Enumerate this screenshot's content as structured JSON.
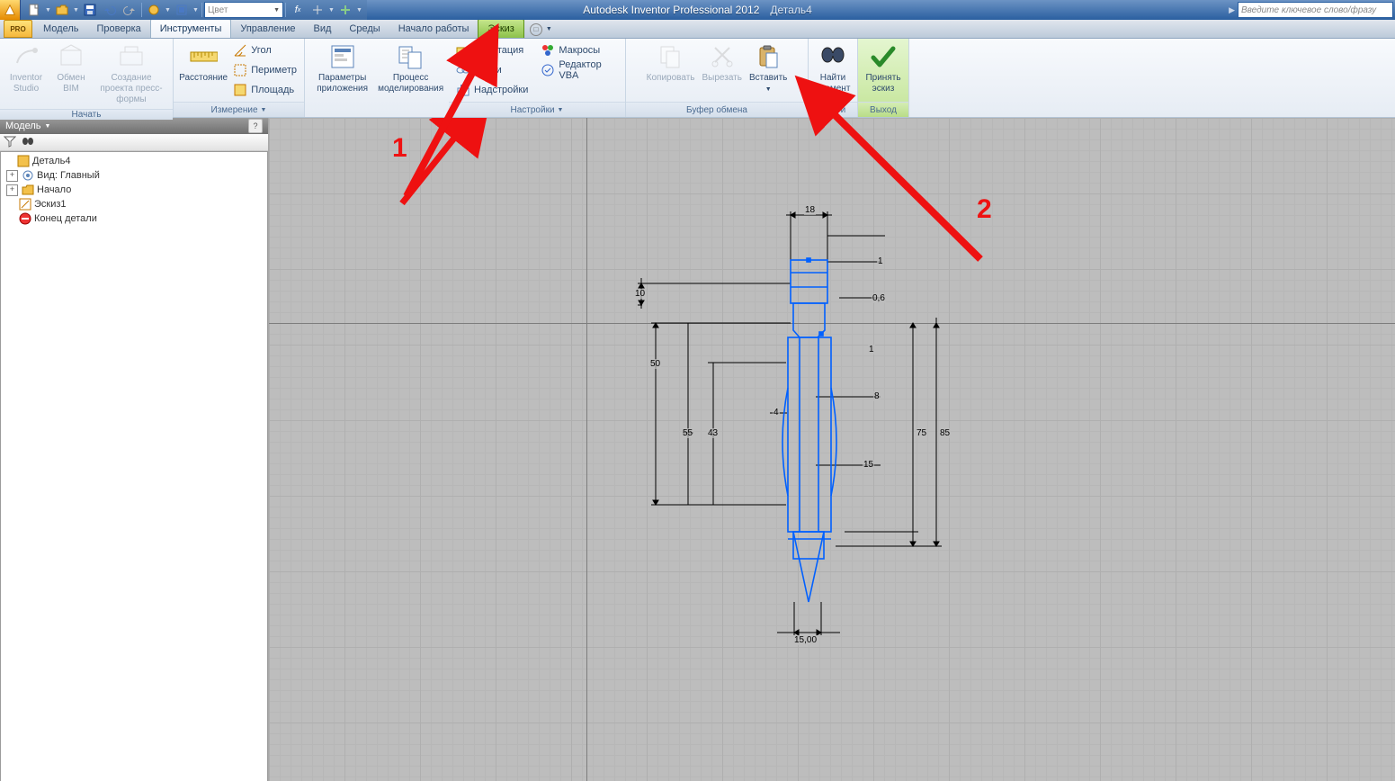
{
  "title": {
    "app": "Autodesk Inventor Professional 2012",
    "doc": "Деталь4"
  },
  "search_placeholder": "Введите ключевое слово/фразу",
  "qat_combo": "Цвет",
  "tabs": [
    "Модель",
    "Проверка",
    "Инструменты",
    "Управление",
    "Вид",
    "Среды",
    "Начало работы",
    "Эскиз"
  ],
  "ribbon": {
    "panels": [
      {
        "label": "Начать",
        "big": [
          {
            "id": "inventor-studio",
            "lbl": "Inventor Studio",
            "disabled": true
          },
          {
            "id": "obmen-bim",
            "lbl": "Обмен BIM",
            "disabled": true
          },
          {
            "id": "press-form",
            "lbl": "Создание проекта пресс-формы",
            "disabled": true
          }
        ]
      },
      {
        "label": "Измерение",
        "dd": true,
        "big": [
          {
            "id": "distance",
            "lbl": "Расстояние"
          }
        ],
        "small": [
          {
            "id": "angle",
            "lbl": "Угол"
          },
          {
            "id": "perimeter",
            "lbl": "Периметр"
          },
          {
            "id": "area",
            "lbl": "Площадь"
          }
        ]
      },
      {
        "label": "",
        "big": [
          {
            "id": "app-params",
            "lbl": "Параметры приложения"
          },
          {
            "id": "model-process",
            "lbl": "Процесс моделирования"
          }
        ]
      },
      {
        "label": "Настройки",
        "dd": true,
        "small": [
          {
            "id": "adaptation",
            "lbl": "Адаптация"
          },
          {
            "id": "links",
            "lbl": "Связи"
          },
          {
            "id": "addins",
            "lbl": "Надстройки"
          }
        ],
        "small2": [
          {
            "id": "macros",
            "lbl": "Макросы"
          },
          {
            "id": "vba",
            "lbl": "Редактор VBA"
          }
        ]
      },
      {
        "label": "Буфер обмена",
        "big": [
          {
            "id": "copy",
            "lbl": "Копировать",
            "disabled": true
          },
          {
            "id": "cut",
            "lbl": "Вырезать",
            "disabled": true
          },
          {
            "id": "paste",
            "lbl": "Вставить",
            "dd": true
          }
        ]
      },
      {
        "label": "Найти",
        "big": [
          {
            "id": "find",
            "lbl": "Найти элемент"
          }
        ]
      },
      {
        "label": "Выход",
        "accept": true,
        "big": [
          {
            "id": "accept",
            "lbl": "Принять эскиз"
          }
        ]
      }
    ]
  },
  "browser": {
    "header": "Модель",
    "tree": [
      {
        "depth": 0,
        "exp": null,
        "icon": "part",
        "label": "Деталь4"
      },
      {
        "depth": 1,
        "exp": "+",
        "icon": "view",
        "label": "Вид: Главный"
      },
      {
        "depth": 1,
        "exp": "+",
        "icon": "folder",
        "label": "Начало"
      },
      {
        "depth": 1,
        "exp": null,
        "icon": "sketch",
        "label": "Эскиз1"
      },
      {
        "depth": 1,
        "exp": null,
        "icon": "end",
        "label": "Конец детали"
      }
    ]
  },
  "dimensions": {
    "d18": "18",
    "d1a": "1",
    "d06": "0,6",
    "d1b": "1",
    "d8": "8",
    "d4": "4",
    "d15": "15",
    "d75": "75",
    "d85": "85",
    "d10": "10",
    "d50": "50",
    "d55": "55",
    "d43": "43",
    "d1500": "15,00"
  },
  "callouts": {
    "one": "1",
    "two": "2"
  }
}
